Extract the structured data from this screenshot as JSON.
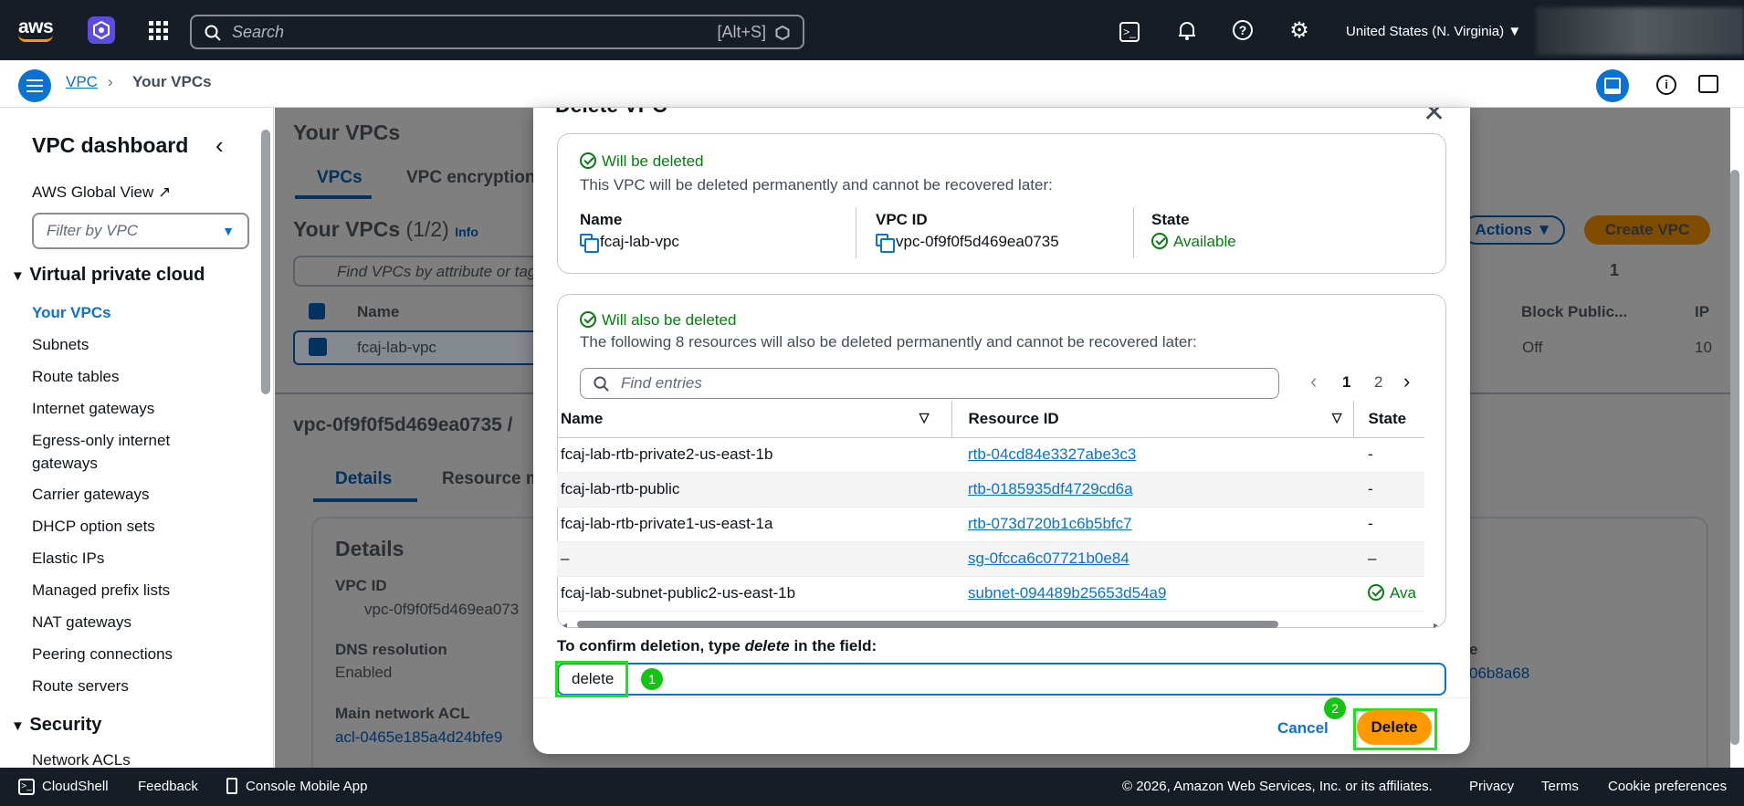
{
  "topnav": {
    "logo": "aws",
    "search_placeholder": "Search",
    "search_shortcut": "[Alt+S]",
    "region": "United States (N. Virginia)"
  },
  "breadcrumb": {
    "root": "VPC",
    "current": "Your VPCs"
  },
  "sidebar": {
    "title": "VPC dashboard",
    "global_view": "AWS Global View",
    "filter_placeholder": "Filter by VPC",
    "section_vpc": "Virtual private cloud",
    "items": [
      "Your VPCs",
      "Subnets",
      "Route tables",
      "Internet gateways",
      "Egress-only internet gateways",
      "Carrier gateways",
      "DHCP option sets",
      "Elastic IPs",
      "Managed prefix lists",
      "NAT gateways",
      "Peering connections",
      "Route servers"
    ],
    "section_security": "Security",
    "security_items": [
      "Network ACLs"
    ]
  },
  "background": {
    "page_title": "Your VPCs",
    "tab_vpcs": "VPCs",
    "tab_encryption": "VPC encryption",
    "list_title": "Your VPCs",
    "list_count": "(1/2)",
    "info": "Info",
    "find_placeholder": "Find VPCs by attribute or tag",
    "col_name": "Name",
    "row_name": "fcaj-lab-vpc",
    "actions": "Actions",
    "create_vpc": "Create VPC",
    "page": "1",
    "col_block_public": "Block Public...",
    "col_ip": "IP",
    "off": "Off",
    "ip_partial": "10",
    "detail_header": "vpc-0f9f0f5d469ea0735 /",
    "tab_details": "Details",
    "tab_resource": "Resource m",
    "details_title": "Details",
    "vpc_id_label": "VPC ID",
    "vpc_id_value": "vpc-0f9f0f5d469ea073",
    "dns_label": "DNS resolution",
    "dns_value": "Enabled",
    "acl_label": "Main network ACL",
    "acl_value": "acl-0465e185a4d24bfe9",
    "right_partial_e": "e",
    "right_partial_link": "06b8a68"
  },
  "modal": {
    "title": "Delete VPC",
    "will_be_deleted": "Will be deleted",
    "vpc_warning": "This VPC will be deleted permanently and cannot be recovered later:",
    "name_label": "Name",
    "name_value": "fcaj-lab-vpc",
    "vpcid_label": "VPC ID",
    "vpcid_value": "vpc-0f9f0f5d469ea0735",
    "state_label": "State",
    "state_value": "Available",
    "also_deleted": "Will also be deleted",
    "resources_warning": "The following 8 resources will also be deleted permanently and cannot be recovered later:",
    "find_placeholder": "Find entries",
    "pages": [
      "1",
      "2"
    ],
    "columns": [
      "Name",
      "Resource ID",
      "State"
    ],
    "rows": [
      {
        "name": "fcaj-lab-rtb-private2-us-east-1b",
        "id": "rtb-04cd84e3327abe3c3",
        "state": "-"
      },
      {
        "name": "fcaj-lab-rtb-public",
        "id": "rtb-0185935df4729cd6a",
        "state": "-"
      },
      {
        "name": "fcaj-lab-rtb-private1-us-east-1a",
        "id": "rtb-073d720b1c6b5bfc7",
        "state": "-"
      },
      {
        "name": "–",
        "id": "sg-0fcca6c07721b0e84",
        "state": "–"
      },
      {
        "name": "fcaj-lab-subnet-public2-us-east-1b",
        "id": "subnet-094489b25653d54a9",
        "state": "Ava"
      }
    ],
    "confirm_prefix": "To confirm deletion, type ",
    "confirm_word": "delete",
    "confirm_suffix": " in the field:",
    "input_value": "delete",
    "cancel": "Cancel",
    "delete": "Delete",
    "badge1": "1",
    "badge2": "2"
  },
  "footer": {
    "cloudshell": "CloudShell",
    "feedback": "Feedback",
    "mobile": "Console Mobile App",
    "copyright": "© 2026, Amazon Web Services, Inc. or its affiliates.",
    "privacy": "Privacy",
    "terms": "Terms",
    "cookies": "Cookie preferences"
  }
}
